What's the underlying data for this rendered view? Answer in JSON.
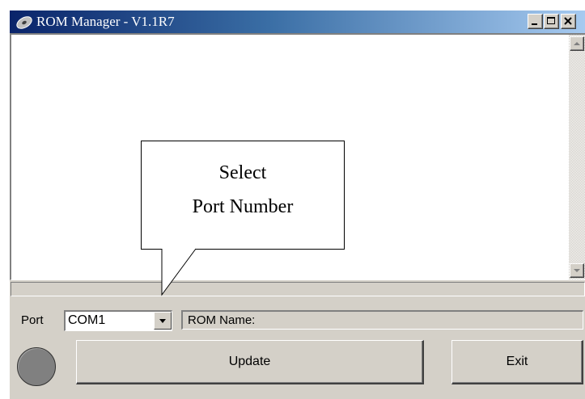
{
  "window": {
    "title": "ROM Manager - V1.1R7",
    "title_icon": "rom-manager-app-icon",
    "controls": [
      "minimize-icon",
      "maximize-icon",
      "close-icon"
    ]
  },
  "log_area": {
    "scrollbar": {
      "up_icon": "scroll-up-arrow-icon",
      "down_icon": "scroll-down-arrow-icon"
    }
  },
  "progress": {
    "value": 0
  },
  "port": {
    "label": "Port",
    "selected": "COM1",
    "dropdown_icon": "chevron-down-icon"
  },
  "rom_name": {
    "label": "ROM Name:"
  },
  "status_led": {
    "color": "#808080"
  },
  "buttons": {
    "update": "Update",
    "exit": "Exit"
  },
  "callout": {
    "line1": "Select",
    "line2": "Port Number"
  },
  "colors": {
    "titlebar_start": "#0a246a",
    "titlebar_end": "#a6caf0",
    "window_face": "#d4d0c8",
    "log_background": "#ffffff"
  }
}
